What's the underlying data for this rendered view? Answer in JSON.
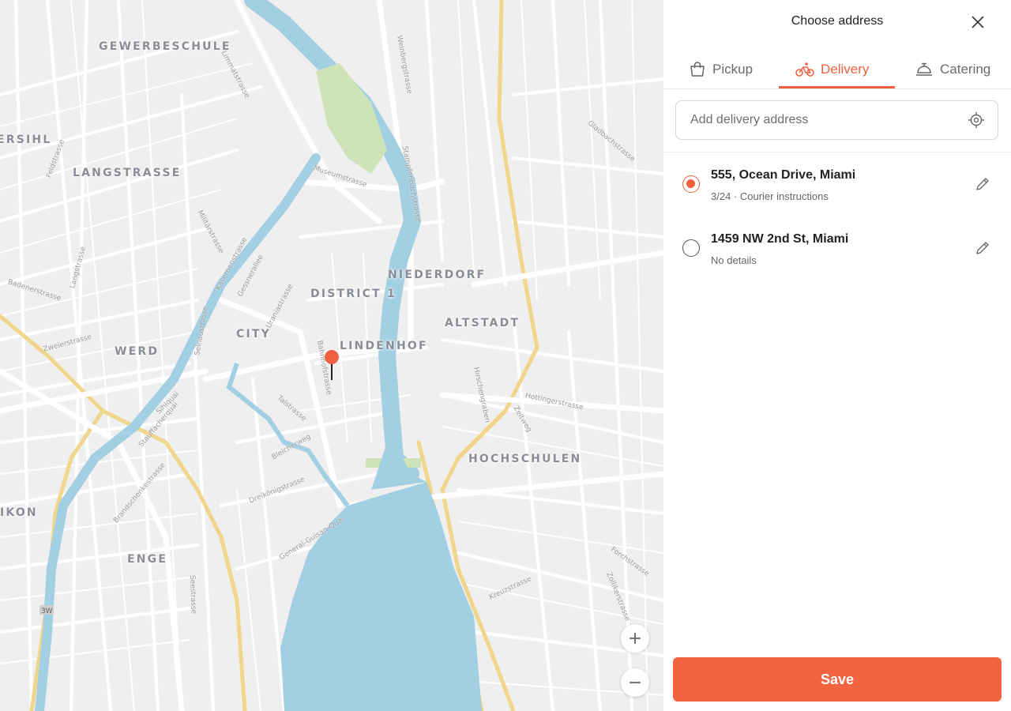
{
  "panel": {
    "title": "Choose address",
    "tabs": [
      {
        "label": "Pickup",
        "icon": "shopping-bag-icon",
        "active": false
      },
      {
        "label": "Delivery",
        "icon": "bicycle-icon",
        "active": true
      },
      {
        "label": "Catering",
        "icon": "serving-cloche-icon",
        "active": false
      }
    ],
    "address_input": {
      "placeholder": "Add delivery address",
      "value": ""
    },
    "addresses": [
      {
        "title": "555, Ocean Drive, Miami",
        "details": "3/24 · Courier instructions",
        "selected": true
      },
      {
        "title": "1459 NW 2nd St, Miami",
        "details": "No details",
        "selected": false
      }
    ],
    "save_label": "Save"
  },
  "map": {
    "districts": [
      "GEWERBESCHULE",
      "ERSIHL",
      "LANGSTRASSE",
      "NIEDERDORF",
      "DISTRICT 1",
      "ALTSTADT",
      "CITY",
      "LINDENHOF",
      "WERD",
      "HOCHSCHULEN",
      "IKON",
      "ENGE"
    ],
    "streets": [
      "Limmatstrasse",
      "Museumstrasse",
      "Weinbergstrasse",
      "Stampfenbachstrasse",
      "Feldstrasse",
      "Langstrasse",
      "Badenerstrasse",
      "Zweierstrasse",
      "Militärstrasse",
      "Kasernenstrasse",
      "Gessnerallee",
      "Uraniastrasse",
      "Bahnhofstrasse",
      "Talstrasse",
      "Bleicherweg",
      "Dreikönigstrasse",
      "General-Guisan-Quai",
      "Seestrasse",
      "Stauffacherquai",
      "Brandschenkestrasse",
      "Hirschengraben",
      "Zeltweg",
      "Hottingerstrasse",
      "Kreuzstrasse",
      "Forchstrasse",
      "Zollikerstrasse",
      "Gladbachstrasse",
      "Selnaustrasse",
      "Sihlquai"
    ],
    "highway_badge": "3W",
    "colors": {
      "water": "#a3cfe3",
      "park": "#cfe3b8",
      "major_road": "#f0d58c",
      "land": "#efefef",
      "pin": "#f06140"
    }
  },
  "colors": {
    "accent": "#f06140",
    "save_button": "#f26440"
  }
}
